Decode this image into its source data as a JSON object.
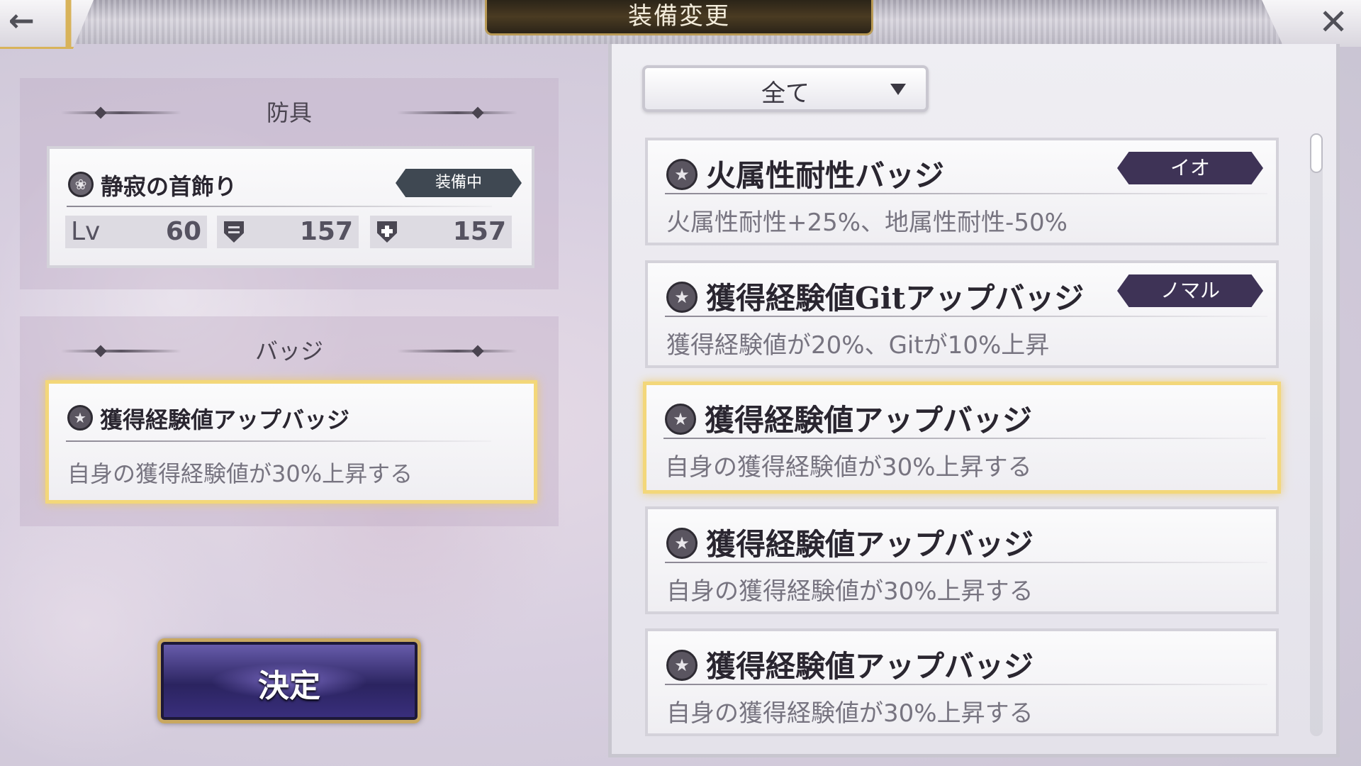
{
  "window": {
    "title": "装備変更"
  },
  "nav": {
    "back_icon": "back-arrow-icon",
    "close_icon": "close-icon"
  },
  "armor_section": {
    "title": "防具",
    "item": {
      "icon": "necklace-icon",
      "name": "静寂の首飾り",
      "status_badge": "装備中",
      "level_label": "Lv",
      "level": "60",
      "defense": "157",
      "magic_defense": "157"
    }
  },
  "badge_section": {
    "title": "バッジ",
    "item": {
      "icon": "star-badge-icon",
      "name": "獲得経験値アップバッジ",
      "description": "自身の獲得経験値が30%上昇する"
    }
  },
  "confirm_button": {
    "label": "決定"
  },
  "filter": {
    "selected": "全て"
  },
  "badge_list": [
    {
      "name": "火属性耐性バッジ",
      "description": "火属性耐性+25%、地属性耐性-50%",
      "tag": "イオ",
      "selected": false
    },
    {
      "name": "獲得経験値Gitアップバッジ",
      "description": "獲得経験値が20%、Gitが10%上昇",
      "tag": "ノマル",
      "selected": false
    },
    {
      "name": "獲得経験値アップバッジ",
      "description": "自身の獲得経験値が30%上昇する",
      "tag": "",
      "selected": true
    },
    {
      "name": "獲得経験値アップバッジ",
      "description": "自身の獲得経験値が30%上昇する",
      "tag": "",
      "selected": false
    },
    {
      "name": "獲得経験値アップバッジ",
      "description": "自身の獲得経験値が30%上昇する",
      "tag": "",
      "selected": false
    }
  ],
  "colors": {
    "accent_gold": "#f3d77a",
    "tag_purple": "#3e3356",
    "equipped_badge": "#3f4852"
  }
}
